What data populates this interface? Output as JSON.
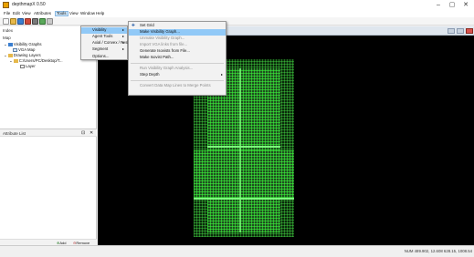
{
  "window": {
    "title": "depthmapX 0.50",
    "minimize": "–",
    "maximize": "▢",
    "close": "✕"
  },
  "menubar": {
    "items": [
      "File",
      "Edit",
      "View",
      "Attributes",
      "Tools",
      "View",
      "Window",
      "Help"
    ]
  },
  "left_panel": {
    "index_title": "Index",
    "map_title": "Map",
    "tree": [
      {
        "label": "Visibility Graphs",
        "level": 0
      },
      {
        "label": "VGA Map",
        "level": 1
      },
      {
        "label": "Drawing Layers",
        "level": 0
      },
      {
        "label": "C:/Users/PC/Desktop/T...",
        "level": 1
      },
      {
        "label": "Layer",
        "level": 2
      }
    ],
    "attributes_title": "Attribute List",
    "attr_pin": "⊡",
    "attr_close": "✕",
    "footer_add": "Add",
    "footer_remove": "Remove"
  },
  "tools_menu": {
    "items": [
      {
        "label": "Visibility",
        "arrow": "▸",
        "highlighted": true
      },
      {
        "label": "Agent Tools",
        "arrow": "▸"
      },
      {
        "label": "Axial / Convex / Pesh",
        "arrow": "▸"
      },
      {
        "label": "Segment",
        "arrow": "▸"
      },
      {
        "label": "Options...",
        "arrow": ""
      }
    ]
  },
  "visibility_menu": {
    "items": [
      {
        "label": "Set Grid",
        "enabled": true,
        "highlighted": false
      },
      {
        "label": "Make Visibility Graph...",
        "enabled": true,
        "highlighted": true
      },
      {
        "label": "Unmake Visibility Graph...",
        "enabled": false
      },
      {
        "label": "Import VGA links from file...",
        "enabled": false
      },
      {
        "label": "Generate Isovists from File...",
        "enabled": true
      },
      {
        "label": "Make Isovist Path...",
        "enabled": true
      },
      {
        "label": "Run Visibility Graph Analysis...",
        "enabled": false
      },
      {
        "label": "Step Depth",
        "enabled": true,
        "arrow": "▸"
      },
      {
        "label": "Convert Data Map Lines to Merge Points",
        "enabled": false
      }
    ]
  },
  "status": {
    "text": "NUM   489.902, 12.608   628.15, 1008.54"
  },
  "colors": {
    "highlight": "#91c9f7",
    "grid_green": "#3cff3c",
    "map_background": "#000000"
  }
}
